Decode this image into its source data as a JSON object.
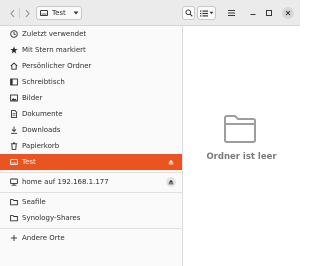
{
  "header": {
    "path_label": "Test",
    "icons": [
      "go-back-icon",
      "go-forward-icon",
      "drive-icon",
      "dropdown-icon",
      "search-icon",
      "list-view-icon",
      "menu-icon",
      "minimize-icon",
      "maximize-icon",
      "close-icon"
    ]
  },
  "sidebar": {
    "items": [
      {
        "label": "Zuletzt verwendet",
        "icon": "clock-icon"
      },
      {
        "label": "Mit Stern markiert",
        "icon": "star-icon"
      },
      {
        "label": "Persönlicher Ordner",
        "icon": "home-icon"
      },
      {
        "label": "Schreibtisch",
        "icon": "desktop-icon"
      },
      {
        "label": "Bilder",
        "icon": "pictures-icon"
      },
      {
        "label": "Dokumente",
        "icon": "documents-icon"
      },
      {
        "label": "Downloads",
        "icon": "downloads-icon"
      },
      {
        "label": "Papierkorb",
        "icon": "trash-icon"
      }
    ],
    "mounts": [
      {
        "label": "Test",
        "icon": "drive-icon",
        "active": true,
        "eject": true
      },
      {
        "label": "home auf 192.168.1.177",
        "icon": "network-drive-icon",
        "active": false,
        "eject": true
      }
    ],
    "bookmarks": [
      {
        "label": "Seafile",
        "icon": "folder-icon"
      },
      {
        "label": "Synology-Shares",
        "icon": "folder-icon"
      }
    ],
    "other": {
      "label": "Andere Orte",
      "icon": "plus-icon"
    }
  },
  "main": {
    "empty_message": "Ordner ist leer",
    "empty_icon": "folder-icon"
  },
  "colors": {
    "accent": "#e95420",
    "header_bg": "#ebebeb",
    "sidebar_bg": "#fafafa",
    "empty_text": "#7a7a7a"
  }
}
